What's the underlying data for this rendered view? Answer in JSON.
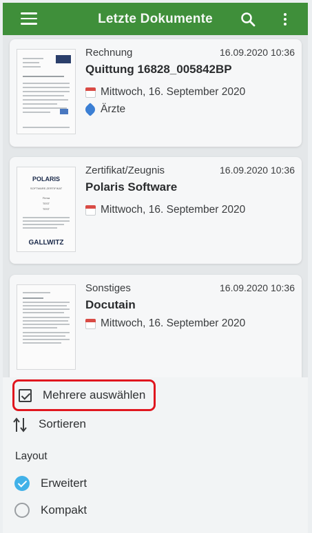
{
  "appbar": {
    "title": "Letzte Dokumente",
    "icons": [
      "hamburger-menu-icon",
      "search-icon",
      "more-vertical-icon"
    ],
    "color": "#3f8f3a"
  },
  "documents": [
    {
      "category": "Rechnung",
      "date": "16.09.2020 10:36",
      "title": "Quittung 16828_005842BP",
      "day": "Mittwoch, 16. September 2020",
      "tag": "Ärzte"
    },
    {
      "category": "Zertifikat/Zeugnis",
      "date": "16.09.2020 10:36",
      "title": "Polaris  Software",
      "day": "Mittwoch, 16. September 2020",
      "thumb_lines": [
        "POLARIS",
        "SOFTWARE-ZERTIFIKAT",
        "Firma",
        "TEST",
        "TEST",
        "GALLWITZ"
      ]
    },
    {
      "category": "Sonstiges",
      "date": "16.09.2020 10:36",
      "title": "Docutain",
      "day": "Mittwoch, 16. September 2020"
    }
  ],
  "sheet": {
    "multi_select": "Mehrere auswählen",
    "sort": "Sortieren",
    "layout_heading": "Layout",
    "layout_options": [
      {
        "label": "Erweitert",
        "selected": true
      },
      {
        "label": "Kompakt",
        "selected": false
      }
    ],
    "highlight_color": "#e0161e",
    "radio_color": "#41b1e8"
  }
}
